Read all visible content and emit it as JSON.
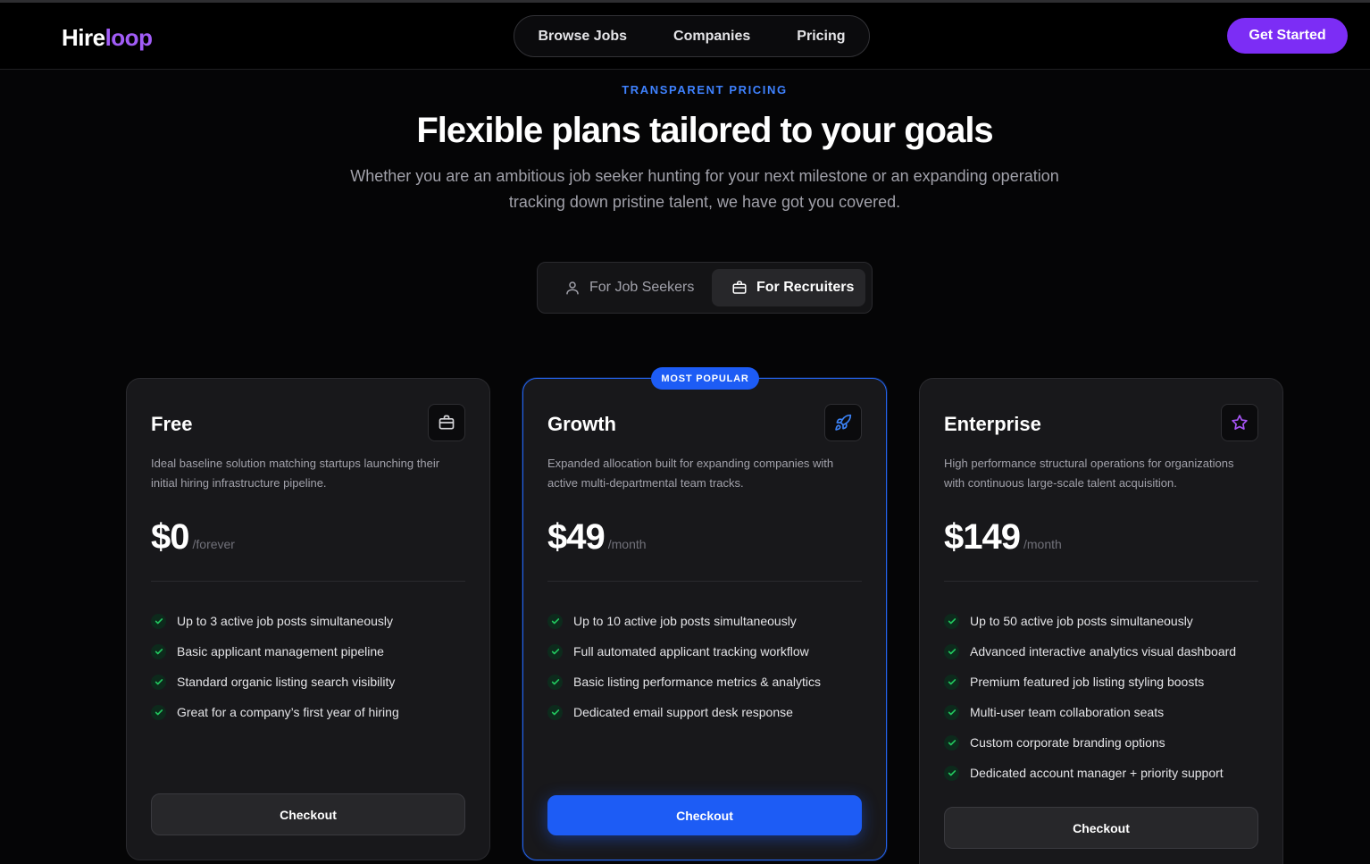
{
  "header": {
    "logo_part1": "Hire",
    "logo_part2": "loop",
    "nav": [
      "Browse Jobs",
      "Companies",
      "Pricing"
    ],
    "cta": "Get Started"
  },
  "hero": {
    "eyebrow": "TRANSPARENT PRICING",
    "title": "Flexible plans tailored to your goals",
    "subtitle": "Whether you are an ambitious job seeker hunting for your next milestone or an expanding operation tracking down pristine talent, we have got you covered."
  },
  "toggle": {
    "seekers": "For Job Seekers",
    "recruiters": "For Recruiters",
    "selected": "recruiters"
  },
  "plans": [
    {
      "name": "Free",
      "icon": "briefcase-icon",
      "description": "Ideal baseline solution matching startups launching their initial hiring infrastructure pipeline.",
      "price": "$0",
      "period": "/forever",
      "features": [
        "Up to 3 active job posts simultaneously",
        "Basic applicant management pipeline",
        "Standard organic listing search visibility",
        "Great for a company’s first year of hiring"
      ],
      "button": "Checkout"
    },
    {
      "name": "Growth",
      "icon": "rocket-icon",
      "badge": "MOST POPULAR",
      "description": "Expanded allocation built for expanding companies with active multi-departmental team tracks.",
      "price": "$49",
      "period": "/month",
      "features": [
        "Up to 10 active job posts simultaneously",
        "Full automated applicant tracking workflow",
        "Basic listing performance metrics & analytics",
        "Dedicated email support desk response"
      ],
      "button": "Checkout"
    },
    {
      "name": "Enterprise",
      "icon": "star-icon",
      "description": "High performance structural operations for organizations with continuous large-scale talent acquisition.",
      "price": "$149",
      "period": "/month",
      "features": [
        "Up to 50 active job posts simultaneously",
        "Advanced interactive analytics visual dashboard",
        "Premium featured job listing styling boosts",
        "Multi-user team collaboration seats",
        "Custom corporate branding options",
        "Dedicated account manager + priority support"
      ],
      "button": "Checkout"
    }
  ],
  "colors": {
    "accent_blue": "#1d5cf5",
    "accent_purple": "#7c2df5",
    "logo_purple": "#a15cf7",
    "check_green": "#22c55e",
    "background": "#050506",
    "card": "#18181b"
  }
}
